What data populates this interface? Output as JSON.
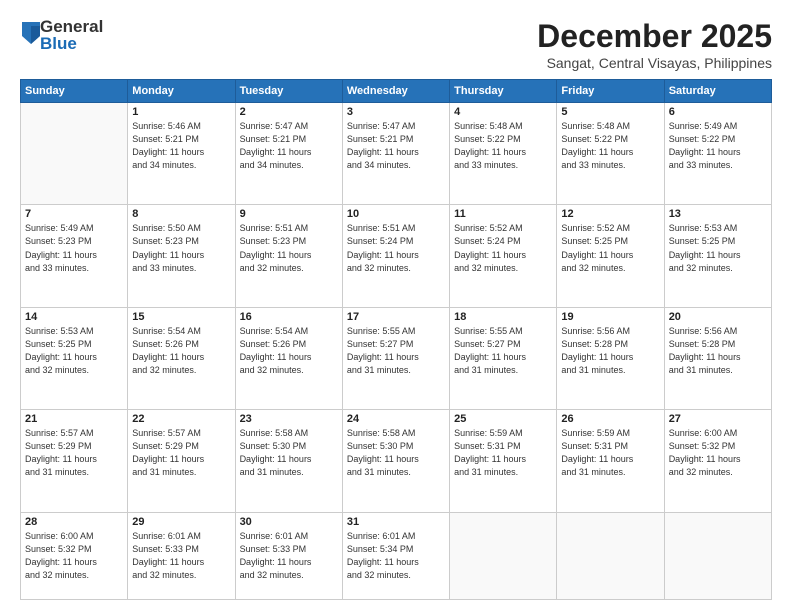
{
  "logo": {
    "general": "General",
    "blue": "Blue"
  },
  "title": "December 2025",
  "location": "Sangat, Central Visayas, Philippines",
  "weekdays": [
    "Sunday",
    "Monday",
    "Tuesday",
    "Wednesday",
    "Thursday",
    "Friday",
    "Saturday"
  ],
  "weeks": [
    [
      {
        "day": "",
        "info": ""
      },
      {
        "day": "1",
        "info": "Sunrise: 5:46 AM\nSunset: 5:21 PM\nDaylight: 11 hours\nand 34 minutes."
      },
      {
        "day": "2",
        "info": "Sunrise: 5:47 AM\nSunset: 5:21 PM\nDaylight: 11 hours\nand 34 minutes."
      },
      {
        "day": "3",
        "info": "Sunrise: 5:47 AM\nSunset: 5:21 PM\nDaylight: 11 hours\nand 34 minutes."
      },
      {
        "day": "4",
        "info": "Sunrise: 5:48 AM\nSunset: 5:22 PM\nDaylight: 11 hours\nand 33 minutes."
      },
      {
        "day": "5",
        "info": "Sunrise: 5:48 AM\nSunset: 5:22 PM\nDaylight: 11 hours\nand 33 minutes."
      },
      {
        "day": "6",
        "info": "Sunrise: 5:49 AM\nSunset: 5:22 PM\nDaylight: 11 hours\nand 33 minutes."
      }
    ],
    [
      {
        "day": "7",
        "info": "Sunrise: 5:49 AM\nSunset: 5:23 PM\nDaylight: 11 hours\nand 33 minutes."
      },
      {
        "day": "8",
        "info": "Sunrise: 5:50 AM\nSunset: 5:23 PM\nDaylight: 11 hours\nand 33 minutes."
      },
      {
        "day": "9",
        "info": "Sunrise: 5:51 AM\nSunset: 5:23 PM\nDaylight: 11 hours\nand 32 minutes."
      },
      {
        "day": "10",
        "info": "Sunrise: 5:51 AM\nSunset: 5:24 PM\nDaylight: 11 hours\nand 32 minutes."
      },
      {
        "day": "11",
        "info": "Sunrise: 5:52 AM\nSunset: 5:24 PM\nDaylight: 11 hours\nand 32 minutes."
      },
      {
        "day": "12",
        "info": "Sunrise: 5:52 AM\nSunset: 5:25 PM\nDaylight: 11 hours\nand 32 minutes."
      },
      {
        "day": "13",
        "info": "Sunrise: 5:53 AM\nSunset: 5:25 PM\nDaylight: 11 hours\nand 32 minutes."
      }
    ],
    [
      {
        "day": "14",
        "info": "Sunrise: 5:53 AM\nSunset: 5:25 PM\nDaylight: 11 hours\nand 32 minutes."
      },
      {
        "day": "15",
        "info": "Sunrise: 5:54 AM\nSunset: 5:26 PM\nDaylight: 11 hours\nand 32 minutes."
      },
      {
        "day": "16",
        "info": "Sunrise: 5:54 AM\nSunset: 5:26 PM\nDaylight: 11 hours\nand 32 minutes."
      },
      {
        "day": "17",
        "info": "Sunrise: 5:55 AM\nSunset: 5:27 PM\nDaylight: 11 hours\nand 31 minutes."
      },
      {
        "day": "18",
        "info": "Sunrise: 5:55 AM\nSunset: 5:27 PM\nDaylight: 11 hours\nand 31 minutes."
      },
      {
        "day": "19",
        "info": "Sunrise: 5:56 AM\nSunset: 5:28 PM\nDaylight: 11 hours\nand 31 minutes."
      },
      {
        "day": "20",
        "info": "Sunrise: 5:56 AM\nSunset: 5:28 PM\nDaylight: 11 hours\nand 31 minutes."
      }
    ],
    [
      {
        "day": "21",
        "info": "Sunrise: 5:57 AM\nSunset: 5:29 PM\nDaylight: 11 hours\nand 31 minutes."
      },
      {
        "day": "22",
        "info": "Sunrise: 5:57 AM\nSunset: 5:29 PM\nDaylight: 11 hours\nand 31 minutes."
      },
      {
        "day": "23",
        "info": "Sunrise: 5:58 AM\nSunset: 5:30 PM\nDaylight: 11 hours\nand 31 minutes."
      },
      {
        "day": "24",
        "info": "Sunrise: 5:58 AM\nSunset: 5:30 PM\nDaylight: 11 hours\nand 31 minutes."
      },
      {
        "day": "25",
        "info": "Sunrise: 5:59 AM\nSunset: 5:31 PM\nDaylight: 11 hours\nand 31 minutes."
      },
      {
        "day": "26",
        "info": "Sunrise: 5:59 AM\nSunset: 5:31 PM\nDaylight: 11 hours\nand 31 minutes."
      },
      {
        "day": "27",
        "info": "Sunrise: 6:00 AM\nSunset: 5:32 PM\nDaylight: 11 hours\nand 32 minutes."
      }
    ],
    [
      {
        "day": "28",
        "info": "Sunrise: 6:00 AM\nSunset: 5:32 PM\nDaylight: 11 hours\nand 32 minutes."
      },
      {
        "day": "29",
        "info": "Sunrise: 6:01 AM\nSunset: 5:33 PM\nDaylight: 11 hours\nand 32 minutes."
      },
      {
        "day": "30",
        "info": "Sunrise: 6:01 AM\nSunset: 5:33 PM\nDaylight: 11 hours\nand 32 minutes."
      },
      {
        "day": "31",
        "info": "Sunrise: 6:01 AM\nSunset: 5:34 PM\nDaylight: 11 hours\nand 32 minutes."
      },
      {
        "day": "",
        "info": ""
      },
      {
        "day": "",
        "info": ""
      },
      {
        "day": "",
        "info": ""
      }
    ]
  ]
}
